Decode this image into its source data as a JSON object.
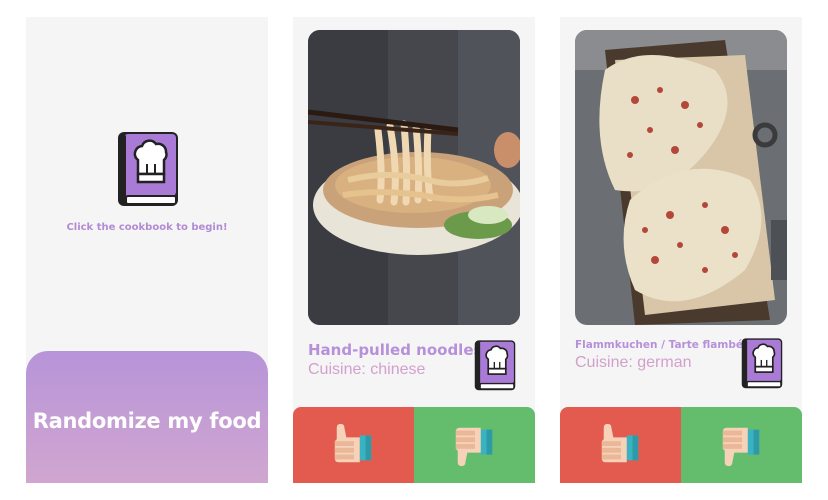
{
  "screen_start": {
    "hint": "Click the cookbook to begin!",
    "button_label": "Randomize my food",
    "icon": "cookbook-icon"
  },
  "cards": [
    {
      "title": "Hand-pulled noodles",
      "cuisine": "Cuisine: chinese",
      "image": "noodles-photo",
      "dislike_icon": "thumbs-down-icon",
      "like_icon": "thumbs-up-icon"
    },
    {
      "title": "Flammkuchen / Tarte flambée",
      "cuisine": "Cuisine: german",
      "image": "flatbread-photo",
      "dislike_icon": "thumbs-down-icon",
      "like_icon": "thumbs-up-icon"
    }
  ],
  "colors": {
    "accent_purple": "#b690d8",
    "cuisine_pink": "#d2a0cc",
    "dislike_red": "#e35b4f",
    "like_green": "#64bc6d"
  }
}
